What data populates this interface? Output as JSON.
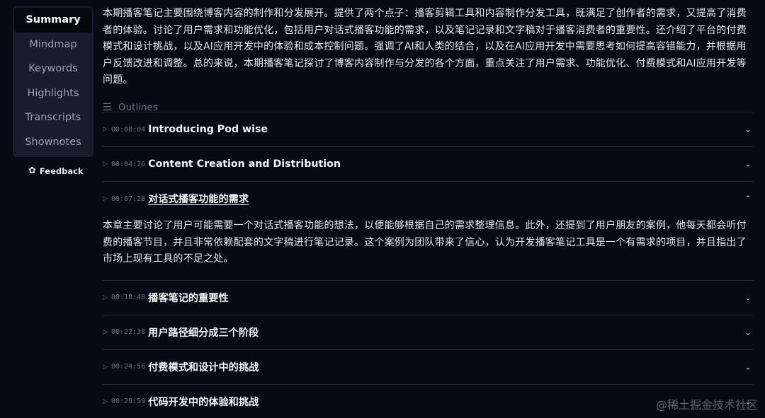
{
  "sidebar": {
    "items": [
      {
        "label": "Summary",
        "active": true
      },
      {
        "label": "Mindmap"
      },
      {
        "label": "Keywords"
      },
      {
        "label": "Highlights"
      },
      {
        "label": "Transcripts"
      },
      {
        "label": "Shownotes"
      }
    ],
    "feedback_label": "Feedback",
    "feedback_icon": "feedback-icon"
  },
  "summary": {
    "text": "本期播客笔记主要围绕博客内容的制作和分发展开。提供了两个点子：播客剪辑工具和内容制作分发工具，既满足了创作者的需求，又提高了消费者的体验。讨论了用户需求和功能优化，包括用户对话式播客功能的需求，以及笔记记录和文字稿对于播客消费者的重要性。还介绍了平台的付费模式和设计挑战，以及AI应用开发中的体验和成本控制问题。强调了AI和人类的结合，以及在AI应用开发中需要思考如何提高容错能力，并根据用户反馈改进和调整。总的来说，本期播客笔记探讨了博客内容制作与分发的各个方面，重点关注了用户需求、功能优化、付费模式和AI应用开发等问题。"
  },
  "outlines": {
    "label": "Outlines",
    "icon": "list-icon",
    "items": [
      {
        "time": "00:00:04",
        "title": "Introducing Pod wise"
      },
      {
        "time": "00:04:26",
        "title": "Content Creation and Distribution"
      },
      {
        "time": "00:07:28",
        "title": "对话式播客功能的需求",
        "body": "本章主要讨论了用户可能需要一个对话式播客功能的想法，以便能够根据自己的需求整理信息。此外，还提到了用户朋友的案例，他每天都会听付费的播客节目，并且非常依赖配套的文字稿进行笔记记录。这个案例为团队带来了信心，认为开发播客笔记工具是一个有需求的项目，并且指出了市场上现有工具的不足之处。"
      },
      {
        "time": "00:10:48",
        "title": "播客笔记的重要性"
      },
      {
        "time": "00:22:38",
        "title": "用户路径细分成三个阶段"
      },
      {
        "time": "00:24:56",
        "title": "付费模式和设计中的挑战"
      },
      {
        "time": "00:29:59",
        "title": "代码开发中的体验和挑战"
      }
    ]
  },
  "watermark": "@稀土掘金技术社区",
  "colors": {
    "background": "#070a14",
    "sidebar": "#171d2a",
    "active_item": "#05070d",
    "divider": "#272c38",
    "muted": "#6b7280"
  }
}
